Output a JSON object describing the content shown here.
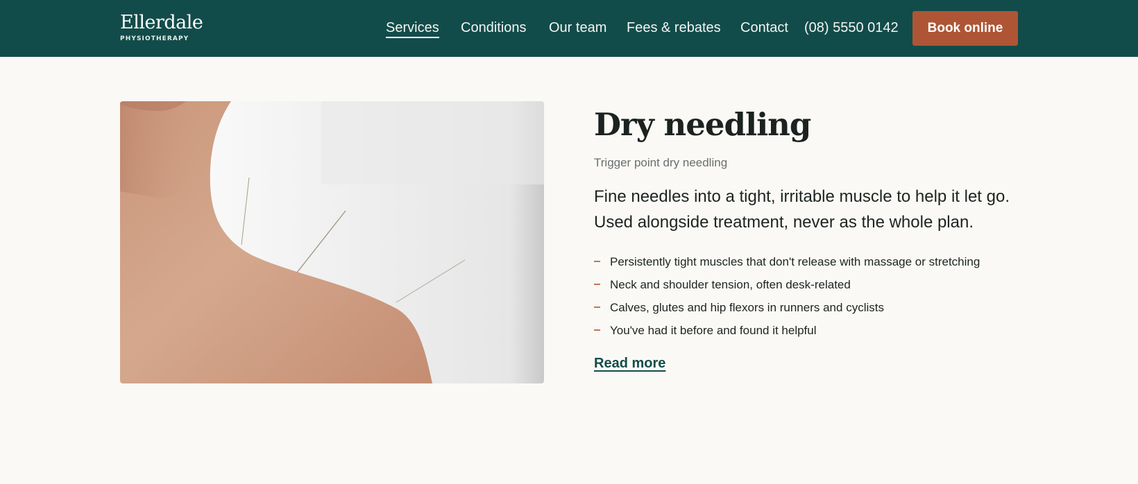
{
  "brand": {
    "name": "Ellerdale",
    "tagline": "PHYSIOTHERAPY"
  },
  "nav": {
    "items": [
      {
        "label": "Services",
        "active": true
      },
      {
        "label": "Conditions",
        "active": false
      },
      {
        "label": "Our team",
        "active": false
      },
      {
        "label": "Fees & rebates",
        "active": false
      },
      {
        "label": "Contact",
        "active": false
      }
    ],
    "phone": "(08) 5550 0142",
    "book_label": "Book online"
  },
  "service": {
    "title": "Dry needling",
    "subtitle": "Trigger point dry needling",
    "lead": "Fine needles into a tight, irritable muscle to help it let go. Used alongside treatment, never as the whole plan.",
    "bullets": [
      "Persistently tight muscles that don't release with massage or stretching",
      "Neck and shoulder tension, often desk-related",
      "Calves, glutes and hip flexors in runners and cyclists",
      "You've had it before and found it helpful"
    ],
    "read_more": "Read more"
  },
  "colors": {
    "header_bg": "#124c4a",
    "accent_button": "#ae5535",
    "page_bg": "#faf9f5",
    "link": "#124c4a",
    "bullet_dash": "#c0765a"
  },
  "icons": {
    "bullet": "dash-icon"
  }
}
